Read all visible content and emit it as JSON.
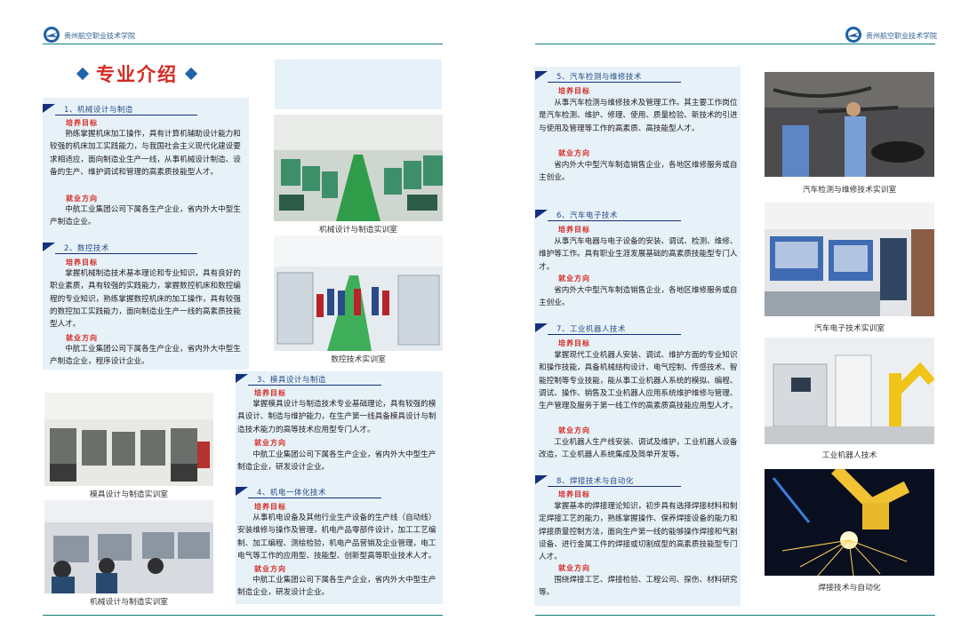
{
  "header": {
    "left_school": "贵州航空职业技术学院",
    "right_school": "贵州航空职业技术学院"
  },
  "page_title": "专业介绍",
  "sections": [
    {
      "heading": "1、机械设计与制造",
      "goal_label": "培养目标",
      "goal_text": "熟练掌握机床加工操作，具有计算机辅助设计能力和较强的机床加工实践能力，与我国社会主义现代化建设要求相适应，面向制造业生产一线，从事机械设计制造、设备的生产、维护调试和管理的高素质技能型人才。",
      "job_label": "就业方向",
      "job_text": "中航工业集团公司下属各生产企业，省内外大中型生产制造企业。"
    },
    {
      "heading": "2、数控技术",
      "goal_label": "培养目标",
      "goal_text": "掌握机械制造技术基本理论和专业知识，具有良好的职业素质，具有较强的实践能力，掌握数控机床和数控编程的专业知识，熟练掌握数控机床的加工操作，具有较强的数控加工实践能力，面向制造业生产一线的高素质技能型人才。",
      "job_label": "就业方向",
      "job_text": "中航工业集团公司下属各生产企业，省内外大中型生产制造企业，程序设计企业。"
    },
    {
      "heading": "3、模具设计与制造",
      "goal_label": "培养目标",
      "goal_text": "掌握模具设计与制造技术专业基础理论，具有较强的模具设计、制造与维护能力，在生产第一线具备模具设计与制造技术能力的高等技术应用型专门人才。",
      "job_label": "就业方向",
      "job_text": "中航工业集团公司下属各生产企业，省内外大中型生产制造企业，研发设计企业。"
    },
    {
      "heading": "4、机电一体化技术",
      "goal_label": "培养目标",
      "goal_text": "从事机电设备及其他行业生产设备的生产线（自动线）安装维修与操作及管理，机电产品零部件设计，加工工艺编制、加工编程、测绘检验，机电产品营销及企业管理，电工电气等工作的应用型、技能型、创新型高等职业技术人才。",
      "job_label": "就业方向",
      "job_text": "中航工业集团公司下属各生产企业，省内外大中型生产制造企业，研发设计企业。"
    },
    {
      "heading": "5、汽车检测与维修技术",
      "goal_label": "培养目标",
      "goal_text": "从事汽车检测与维修技术及管理工作。其主要工作岗位是汽车检测、维护、修理、使用、质量检验、新技术的引进与使用及管理等工作的高素质、高技能型人才。",
      "job_label": "就业方向",
      "job_text": "省内外大中型汽车制造销售企业，各地区维修服务或自主创业。"
    },
    {
      "heading": "6、汽车电子技术",
      "goal_label": "培养目标",
      "goal_text": "从事汽车电器与电子设备的安装、调试、检测、维修、维护等工作。具有职业生涯发展基础的高素质技能型专门人才。",
      "job_label": "就业方向",
      "job_text": "省内外大中型汽车制造销售企业，各地区维修服务或自主创业。"
    },
    {
      "heading": "7、工业机器人技术",
      "goal_label": "培养目标",
      "goal_text": "掌握现代工业机器人安装、调试、维护方面的专业知识和操作技能，具备机械结构设计、电气控制、传感技术、智能控制等专业技能，能从事工业机器人系统的模拟、编程、调试、操作、销售及工业机器人应用系统维护维修与管理、生产管理及服务于第一线工作的高素质高技能应用型人才。",
      "job_label": "就业方向",
      "job_text": "工业机器人生产线安装、调试及维护，工业机器人设备改造，工业机器人系统集成及简单开发等。"
    },
    {
      "heading": "8、焊接技术与自动化",
      "goal_label": "培养目标",
      "goal_text": "掌握基本的焊接理论知识，初步具有选择焊接材料和制定焊接工艺的能力，熟练掌握操作、保养焊接设备的能力和焊接质量控制方法，面向生产第一线的能够操作焊接和气割设备、进行金属工件的焊接或切割成型的高素质技能型专门人才。",
      "job_label": "就业方向",
      "job_text": "围绕焊接工艺、焊接检验、工程公司、探伤、材料研究等。"
    }
  ],
  "captions": {
    "jixie": "机械设计与制造实训室",
    "shukong": "数控技术实训室",
    "muju": "模具设计与制造实训室",
    "jixie2": "机械设计与制造实训室",
    "qiche_jiance": "汽车检测与维修技术实训室",
    "qiche_dianzi": "汽车电子技术实训室",
    "robot": "工业机器人技术",
    "weld": "焊接技术与自动化"
  },
  "colors": {
    "accent_red": "#d42a22",
    "heading_blue": "#14307f",
    "panel_bg": "#e7f1f8",
    "rule_teal": "#0f7f7f"
  }
}
